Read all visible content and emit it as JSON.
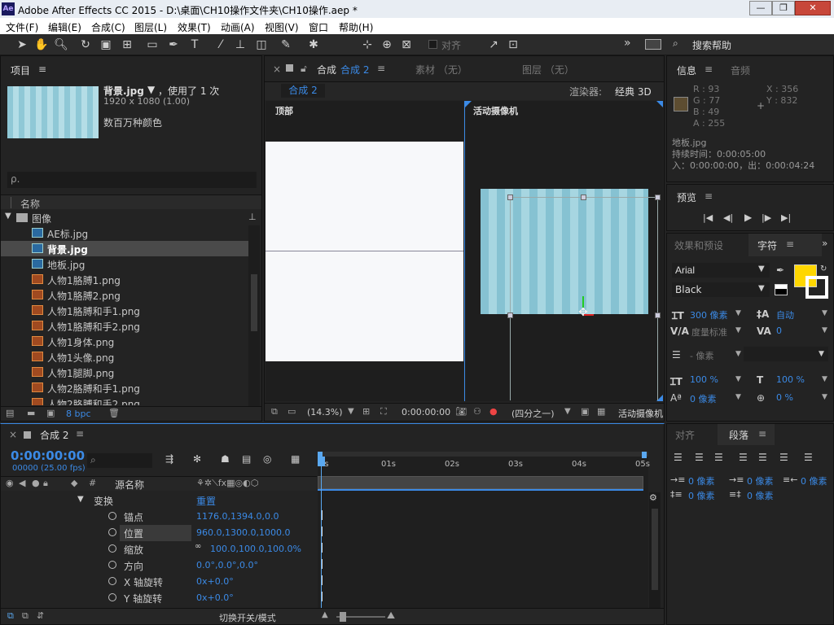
{
  "app": {
    "title": "Adobe After Effects CC 2015 - D:\\桌面\\CH10操作文件夹\\CH10操作.aep *",
    "logo": "Ae",
    "controls": [
      "—",
      "❐",
      "✕"
    ]
  },
  "menu": [
    "文件(F)",
    "编辑(E)",
    "合成(C)",
    "图层(L)",
    "效果(T)",
    "动画(A)",
    "视图(V)",
    "窗口",
    "帮助(H)"
  ],
  "toolbar": {
    "align_label": "对齐",
    "search_help": "搜索帮助",
    "more": "»"
  },
  "project": {
    "title": "项目",
    "selected_name": "背景.jpg",
    "used": "，使用了 1 次",
    "dims": "1920 x 1080 (1.00)",
    "colors": "数百万种颜色",
    "search_placeholder": "ρ.",
    "col_name": "名称",
    "folder": "图像",
    "files": [
      "AE标.jpg",
      "背景.jpg",
      "地板.jpg",
      "人物1胳膊1.png",
      "人物1胳膊2.png",
      "人物1胳膊和手1.png",
      "人物1胳膊和手2.png",
      "人物1身体.png",
      "人物1头像.png",
      "人物1腿脚.png",
      "人物2胳膊和手1.png",
      "人物2胳膊和手2.png"
    ],
    "bpc": "8 bpc"
  },
  "composition": {
    "tab_label": "合成",
    "tab_name": "合成 2",
    "footage_tab": "素材 （无）",
    "layer_tab": "图层 （无）",
    "comp_button": "合成 2",
    "renderer_label": "渲染器:",
    "renderer": "经典 3D",
    "view_top": "顶部",
    "view_active": "活动摄像机",
    "zoom": "(14.3%)",
    "timecode": "0:00:00:00",
    "resolution": "(四分之一)",
    "active_camera": "活动摄像机"
  },
  "info": {
    "tab_info": "信息",
    "tab_audio": "音频",
    "r": "R : 93",
    "g": "G : 77",
    "b": "B : 49",
    "a": "A : 255",
    "x": "X : 356",
    "y": "Y : 832",
    "swatch": "#5d4d31",
    "file": "地板.jpg",
    "duration": "持续时间：0:00:05:00",
    "inout": "入：0:00:00:00，出：0:00:04:24"
  },
  "preview": {
    "title": "预览",
    "buttons": [
      "|◀",
      "◀|",
      "▶",
      "|▶",
      "▶|"
    ]
  },
  "character": {
    "tab_effects": "效果和预设",
    "tab_char": "字符",
    "font": "Arial",
    "style": "Black",
    "fill_color": "#ffd700",
    "size": "300 像素",
    "leading": "自动",
    "kerning": "度量标准",
    "tracking": "0",
    "stroke": "- 像素",
    "vscale": "100 %",
    "hscale": "100 %",
    "baseline": "0 像素",
    "tsume": "0 %"
  },
  "timeline": {
    "comp": "合成 2",
    "time": "0:00:00:00",
    "frames": "00000 (25.00 fps)",
    "col_source": "源名称",
    "ruler": [
      "0s",
      "01s",
      "02s",
      "03s",
      "04s",
      "05s"
    ],
    "transform": "变换",
    "reset": "重置",
    "props": [
      {
        "name": "锚点",
        "value": "1176.0,1394.0,0.0"
      },
      {
        "name": "位置",
        "value": "960.0,1300.0,1000.0"
      },
      {
        "name": "缩放",
        "value": "100.0,100.0,100.0%"
      },
      {
        "name": "方向",
        "value": "0.0°,0.0°,0.0°"
      },
      {
        "name": "X 轴旋转",
        "value": "0x+0.0°"
      },
      {
        "name": "Y 轴旋转",
        "value": "0x+0.0°"
      }
    ],
    "toggle_modes": "切换开关/模式"
  },
  "paragraph": {
    "tab_align": "对齐",
    "tab_para": "段落",
    "indent_left": "0 像素",
    "indent_first": "0 像素",
    "indent_right": "0 像素",
    "space_before": "0 像素",
    "space_after": "0 像素"
  }
}
